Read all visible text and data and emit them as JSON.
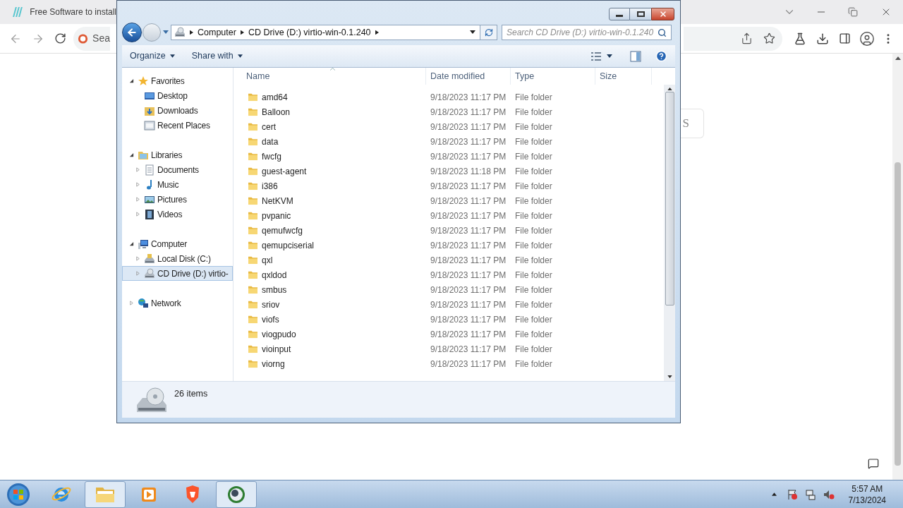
{
  "browser": {
    "tab": {
      "title": "Free Software to install"
    },
    "omnibox": {
      "value": "Sea"
    },
    "page": {
      "button_text": "S"
    }
  },
  "explorer": {
    "breadcrumb": [
      "Computer",
      "CD Drive (D:) virtio-win-0.1.240"
    ],
    "search": {
      "placeholder": "Search CD Drive (D:) virtio-win-0.1.240"
    },
    "commands": [
      "Organize",
      "Share with"
    ],
    "nav": [
      {
        "label": "Favorites",
        "kind": "star",
        "expanded": true,
        "selected": false,
        "children": [
          {
            "label": "Desktop",
            "kind": "desktop",
            "selected": false
          },
          {
            "label": "Downloads",
            "kind": "downloads",
            "selected": false
          },
          {
            "label": "Recent Places",
            "kind": "recent",
            "selected": false
          }
        ]
      },
      {
        "label": "Libraries",
        "kind": "library",
        "expanded": true,
        "selected": false,
        "children": [
          {
            "label": "Documents",
            "kind": "documents",
            "expanded": false,
            "selected": false
          },
          {
            "label": "Music",
            "kind": "music",
            "expanded": false,
            "selected": false
          },
          {
            "label": "Pictures",
            "kind": "pictures",
            "expanded": false,
            "selected": false
          },
          {
            "label": "Videos",
            "kind": "videos",
            "expanded": false,
            "selected": false
          }
        ]
      },
      {
        "label": "Computer",
        "kind": "computer",
        "expanded": true,
        "selected": false,
        "children": [
          {
            "label": "Local Disk (C:)",
            "kind": "disk",
            "expanded": false,
            "selected": false
          },
          {
            "label": "CD Drive (D:) virtio-",
            "kind": "cd",
            "expanded": false,
            "selected": true
          }
        ]
      },
      {
        "label": "Network",
        "kind": "network",
        "expanded": false,
        "selected": false
      }
    ],
    "columns": [
      "Name",
      "Date modified",
      "Type",
      "Size"
    ],
    "rows": [
      {
        "name": "amd64",
        "date": "9/18/2023 11:17 PM",
        "type": "File folder"
      },
      {
        "name": "Balloon",
        "date": "9/18/2023 11:17 PM",
        "type": "File folder"
      },
      {
        "name": "cert",
        "date": "9/18/2023 11:17 PM",
        "type": "File folder"
      },
      {
        "name": "data",
        "date": "9/18/2023 11:17 PM",
        "type": "File folder"
      },
      {
        "name": "fwcfg",
        "date": "9/18/2023 11:17 PM",
        "type": "File folder"
      },
      {
        "name": "guest-agent",
        "date": "9/18/2023 11:18 PM",
        "type": "File folder"
      },
      {
        "name": "i386",
        "date": "9/18/2023 11:17 PM",
        "type": "File folder"
      },
      {
        "name": "NetKVM",
        "date": "9/18/2023 11:17 PM",
        "type": "File folder"
      },
      {
        "name": "pvpanic",
        "date": "9/18/2023 11:17 PM",
        "type": "File folder"
      },
      {
        "name": "qemufwcfg",
        "date": "9/18/2023 11:17 PM",
        "type": "File folder"
      },
      {
        "name": "qemupciserial",
        "date": "9/18/2023 11:17 PM",
        "type": "File folder"
      },
      {
        "name": "qxl",
        "date": "9/18/2023 11:17 PM",
        "type": "File folder"
      },
      {
        "name": "qxldod",
        "date": "9/18/2023 11:17 PM",
        "type": "File folder"
      },
      {
        "name": "smbus",
        "date": "9/18/2023 11:17 PM",
        "type": "File folder"
      },
      {
        "name": "sriov",
        "date": "9/18/2023 11:17 PM",
        "type": "File folder"
      },
      {
        "name": "viofs",
        "date": "9/18/2023 11:17 PM",
        "type": "File folder"
      },
      {
        "name": "viogpudo",
        "date": "9/18/2023 11:17 PM",
        "type": "File folder"
      },
      {
        "name": "vioinput",
        "date": "9/18/2023 11:17 PM",
        "type": "File folder"
      },
      {
        "name": "viorng",
        "date": "9/18/2023 11:17 PM",
        "type": "File folder"
      }
    ],
    "status": "26 items"
  },
  "taskbar": {
    "apps": [
      {
        "kind": "ie",
        "selected": false
      },
      {
        "kind": "folder",
        "selected": true
      },
      {
        "kind": "media",
        "selected": false
      },
      {
        "kind": "lion",
        "selected": false
      },
      {
        "kind": "globe",
        "selected": true
      }
    ],
    "clock": {
      "time": "5:57 AM",
      "date": "7/13/2024"
    }
  }
}
